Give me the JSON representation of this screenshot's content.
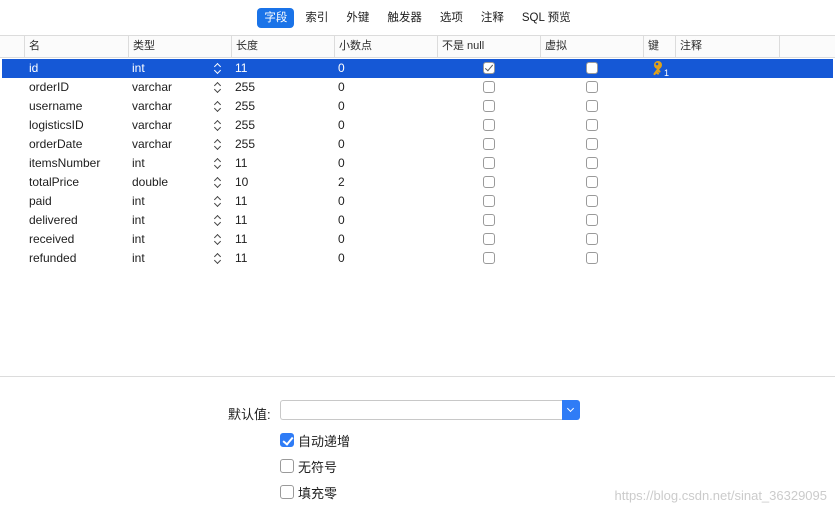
{
  "tabs": [
    {
      "label": "字段",
      "active": true
    },
    {
      "label": "索引",
      "active": false
    },
    {
      "label": "外键",
      "active": false
    },
    {
      "label": "触发器",
      "active": false
    },
    {
      "label": "选项",
      "active": false
    },
    {
      "label": "注释",
      "active": false
    },
    {
      "label": "SQL 预览",
      "active": false
    }
  ],
  "columns": [
    "名",
    "类型",
    "长度",
    "小数点",
    "不是 null",
    "虚拟",
    "键",
    "注释"
  ],
  "rows": [
    {
      "name": "id",
      "type": "int",
      "length": "11",
      "decimals": "0",
      "not_null": true,
      "virtual": false,
      "key": true,
      "selected": true
    },
    {
      "name": "orderID",
      "type": "varchar",
      "length": "255",
      "decimals": "0",
      "not_null": false,
      "virtual": false,
      "key": false
    },
    {
      "name": "username",
      "type": "varchar",
      "length": "255",
      "decimals": "0",
      "not_null": false,
      "virtual": false,
      "key": false
    },
    {
      "name": "logisticsID",
      "type": "varchar",
      "length": "255",
      "decimals": "0",
      "not_null": false,
      "virtual": false,
      "key": false
    },
    {
      "name": "orderDate",
      "type": "varchar",
      "length": "255",
      "decimals": "0",
      "not_null": false,
      "virtual": false,
      "key": false
    },
    {
      "name": "itemsNumber",
      "type": "int",
      "length": "11",
      "decimals": "0",
      "not_null": false,
      "virtual": false,
      "key": false
    },
    {
      "name": "totalPrice",
      "type": "double",
      "length": "10",
      "decimals": "2",
      "not_null": false,
      "virtual": false,
      "key": false
    },
    {
      "name": "paid",
      "type": "int",
      "length": "11",
      "decimals": "0",
      "not_null": false,
      "virtual": false,
      "key": false
    },
    {
      "name": "delivered",
      "type": "int",
      "length": "11",
      "decimals": "0",
      "not_null": false,
      "virtual": false,
      "key": false
    },
    {
      "name": "received",
      "type": "int",
      "length": "11",
      "decimals": "0",
      "not_null": false,
      "virtual": false,
      "key": false
    },
    {
      "name": "refunded",
      "type": "int",
      "length": "11",
      "decimals": "0",
      "not_null": false,
      "virtual": false,
      "key": false
    }
  ],
  "key_badge": "1",
  "bottom": {
    "default_label": "默认值:",
    "default_value": "",
    "options": [
      {
        "label": "自动递增",
        "checked": true
      },
      {
        "label": "无符号",
        "checked": false
      },
      {
        "label": "填充零",
        "checked": false
      }
    ]
  },
  "watermark": "https://blog.csdn.net/sinat_36329095",
  "colors": {
    "accent": "#1a73e8",
    "selection": "#1558d6",
    "key": "#e0a21a"
  }
}
